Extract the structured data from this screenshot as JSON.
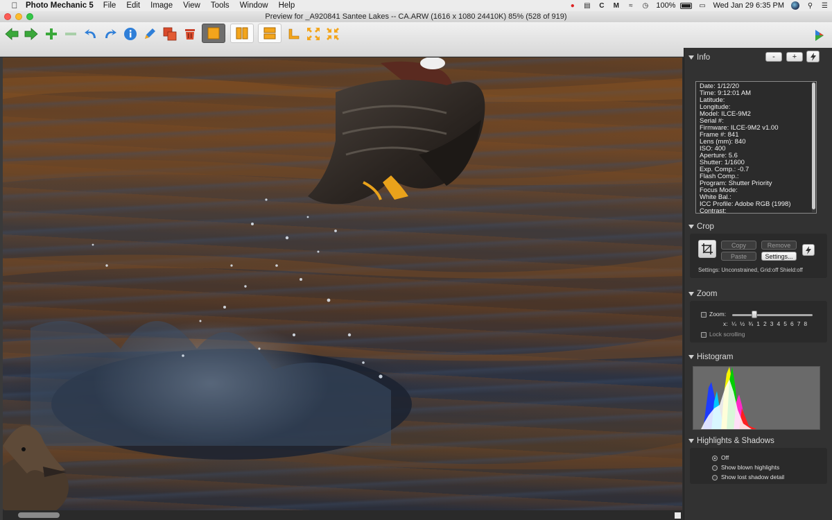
{
  "menubar": {
    "app_name": "Photo Mechanic 5",
    "items": [
      "File",
      "Edit",
      "Image",
      "View",
      "Tools",
      "Window",
      "Help"
    ],
    "status": {
      "battery": "100%",
      "datetime": "Wed Jan 29  6:35 PM"
    }
  },
  "window": {
    "title": "Preview for _A920841  Santee Lakes -- CA.ARW (1616 x 1080 24410K) 85% (528 of 919)"
  },
  "toolbar": {
    "buttons": [
      "back-arrow",
      "forward-arrow",
      "add",
      "remove",
      "rotate-left",
      "rotate-right",
      "info",
      "edit-pen",
      "copy-stack",
      "trash",
      "single-view",
      "two-up-vertical",
      "two-up-horizontal",
      "crop-corner",
      "grid-arrows-left",
      "grid-arrows-right"
    ]
  },
  "info": {
    "title": "Info",
    "minus": "-",
    "plus": "+",
    "lines": [
      "Date: 1/12/20",
      "Time: 9:12:01 AM",
      "Latitude:",
      "Longitude:",
      "Model: ILCE-9M2",
      "Serial #:",
      "Firmware: ILCE-9M2 v1.00",
      "Frame #: 841",
      "Lens (mm): 840",
      "ISO: 400",
      "Aperture: 5.6",
      "Shutter: 1/1600",
      "Exp. Comp.: -0.7",
      "Flash Comp.:",
      "Program: Shutter Priority",
      "Focus Mode:",
      "White Bal.:",
      "ICC Profile: Adobe RGB (1998)",
      "Contrast:"
    ]
  },
  "crop": {
    "title": "Crop",
    "copy": "Copy",
    "remove": "Remove",
    "paste": "Paste",
    "settings_btn": "Settings...",
    "settings_text": "Settings:   Unconstrained, Grid:off Shield:off"
  },
  "zoom": {
    "title": "Zoom",
    "zoom_label": "Zoom:",
    "x_label": "x:",
    "scale": [
      "¼",
      "½",
      "¾",
      "1",
      "2",
      "3",
      "4",
      "5",
      "6",
      "7",
      "8"
    ],
    "lock_label": "Lock scrolling"
  },
  "histogram": {
    "title": "Histogram"
  },
  "highlights": {
    "title": "Highlights & Shadows",
    "options": [
      "Off",
      "Show blown highlights",
      "Show lost shadow detail"
    ],
    "selected": 0
  },
  "colors": {
    "accent_green": "#3aa83a",
    "accent_blue": "#2f7fd8",
    "accent_orange": "#f3a51c",
    "panel_bg": "#323232"
  }
}
